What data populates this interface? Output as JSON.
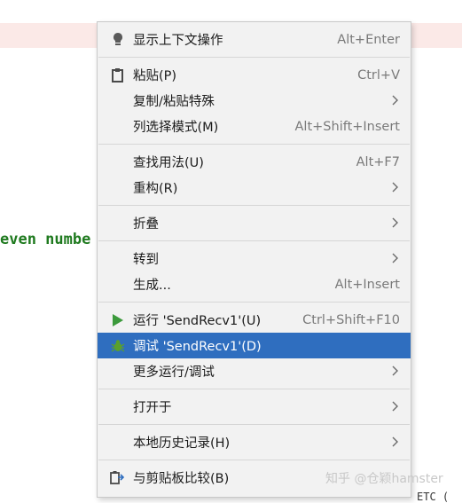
{
  "editor": {
    "code_fragment": "even numbe",
    "bottom_fragment": "ETC ("
  },
  "menu": {
    "items": [
      {
        "label": "显示上下文操作",
        "shortcut": "Alt+Enter",
        "icon": "lightbulb-icon"
      },
      {
        "label": "粘贴(P)",
        "shortcut": "Ctrl+V",
        "icon": "clipboard-icon"
      },
      {
        "label": "复制/粘贴特殊",
        "submenu": true
      },
      {
        "label": "列选择模式(M)",
        "shortcut": "Alt+Shift+Insert"
      },
      {
        "label": "查找用法(U)",
        "shortcut": "Alt+F7"
      },
      {
        "label": "重构(R)",
        "submenu": true
      },
      {
        "label": "折叠",
        "submenu": true
      },
      {
        "label": "转到",
        "submenu": true
      },
      {
        "label": "生成...",
        "shortcut": "Alt+Insert"
      },
      {
        "label": "运行 'SendRecv1'(U)",
        "shortcut": "Ctrl+Shift+F10",
        "icon": "run-play-icon"
      },
      {
        "label": "调试 'SendRecv1'(D)",
        "icon": "debug-bug-icon",
        "selected": true
      },
      {
        "label": "更多运行/调试",
        "submenu": true
      },
      {
        "label": "打开于",
        "submenu": true
      },
      {
        "label": "本地历史记录(H)",
        "submenu": true
      },
      {
        "label": "与剪贴板比较(B)",
        "icon": "compare-clipboard-icon"
      }
    ]
  },
  "watermark": "知乎 @仓颖hamster",
  "colors": {
    "selection": "#2f6ebf",
    "run_icon": "#3c9a3c",
    "debug_icon": "#5aa02c",
    "code_green": "#1f7a1f"
  }
}
